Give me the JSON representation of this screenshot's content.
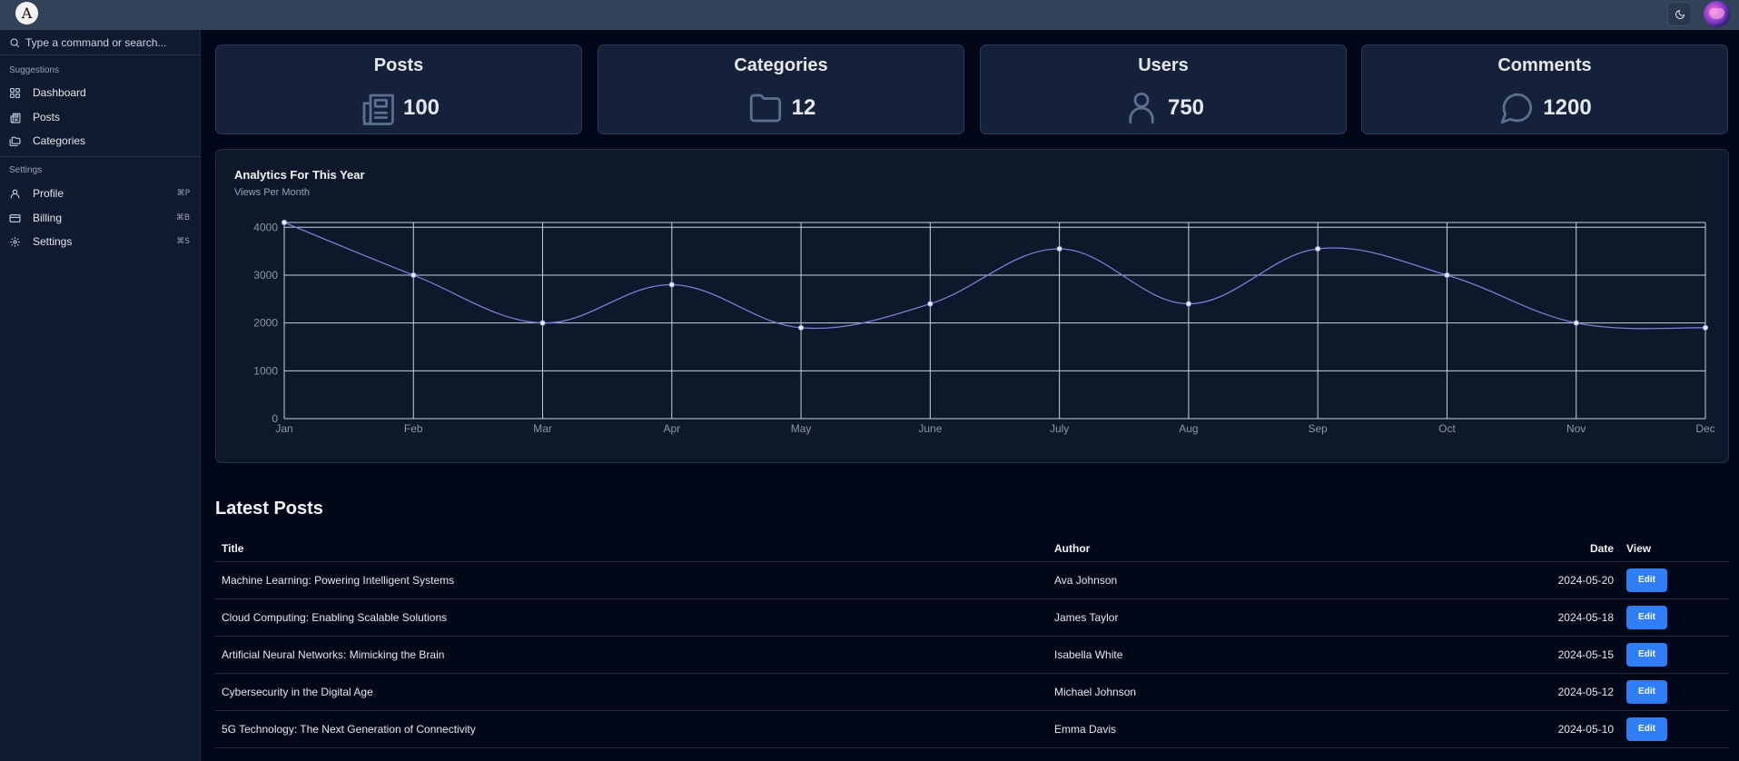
{
  "app": {
    "logo_text": "A"
  },
  "sidebar": {
    "search_placeholder": "Type a command or search...",
    "suggestions_title": "Suggestions",
    "settings_title": "Settings",
    "suggestions": [
      {
        "label": "Dashboard",
        "icon": "dashboard-icon"
      },
      {
        "label": "Posts",
        "icon": "newspaper-icon"
      },
      {
        "label": "Categories",
        "icon": "folders-icon"
      }
    ],
    "settings": [
      {
        "label": "Profile",
        "icon": "user-icon",
        "shortcut": "⌘P"
      },
      {
        "label": "Billing",
        "icon": "credit-card-icon",
        "shortcut": "⌘B"
      },
      {
        "label": "Settings",
        "icon": "gear-icon",
        "shortcut": "⌘S"
      }
    ]
  },
  "stats": [
    {
      "title": "Posts",
      "value": "100",
      "icon": "newspaper-icon"
    },
    {
      "title": "Categories",
      "value": "12",
      "icon": "folder-icon"
    },
    {
      "title": "Users",
      "value": "750",
      "icon": "user-icon"
    },
    {
      "title": "Comments",
      "value": "1200",
      "icon": "message-circle-icon"
    }
  ],
  "chart_data": {
    "type": "line",
    "title": "Analytics For This Year",
    "subtitle": "Views Per Month",
    "categories": [
      "Jan",
      "Feb",
      "Mar",
      "Apr",
      "May",
      "June",
      "July",
      "Aug",
      "Sep",
      "Oct",
      "Nov",
      "Dec"
    ],
    "series": [
      {
        "values": [
          4100,
          3000,
          2000,
          2800,
          1900,
          2400,
          3550,
          2400,
          3550,
          3000,
          2000,
          1900
        ]
      }
    ],
    "yticks": [
      0,
      1000,
      2000,
      3000,
      4000
    ],
    "ylim": [
      0,
      4100
    ],
    "grid": true,
    "line_color": "#7b7fd6"
  },
  "posts": {
    "heading": "Latest Posts",
    "columns": {
      "title": "Title",
      "author": "Author",
      "date": "Date",
      "view": "View"
    },
    "edit_label": "Edit",
    "rows": [
      {
        "title": "Machine Learning: Powering Intelligent Systems",
        "author": "Ava Johnson",
        "date": "2024-05-20"
      },
      {
        "title": "Cloud Computing: Enabling Scalable Solutions",
        "author": "James Taylor",
        "date": "2024-05-18"
      },
      {
        "title": "Artificial Neural Networks: Mimicking the Brain",
        "author": "Isabella White",
        "date": "2024-05-15"
      },
      {
        "title": "Cybersecurity in the Digital Age",
        "author": "Michael Johnson",
        "date": "2024-05-12"
      },
      {
        "title": "5G Technology: The Next Generation of Connectivity",
        "author": "Emma Davis",
        "date": "2024-05-10"
      }
    ]
  },
  "colors": {
    "accent": "#2f7ef6",
    "background": "#030818",
    "topbar": "#324258",
    "sidebar": "#0f1a2e",
    "card": "#15213a"
  }
}
